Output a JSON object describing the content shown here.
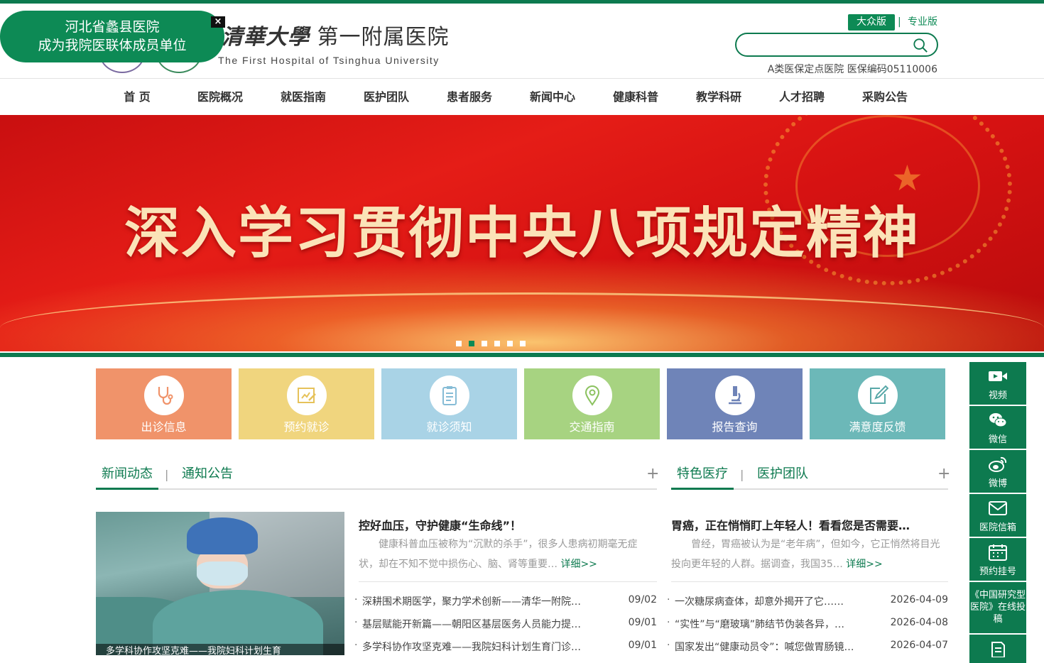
{
  "header": {
    "logo_calligraphy": "清華大學",
    "logo_name": "第一附属医院",
    "logo_en": "The First Hospital of Tsinghua University",
    "badge_line1": "河北省蠡县医院",
    "badge_line2": "成为我院医联体成员单位",
    "badge_close": "×",
    "version_public": "大众版",
    "version_sep": "|",
    "version_pro": "专业版",
    "search_placeholder": "",
    "insurance": "A类医保定点医院  医保编码05110006"
  },
  "nav": [
    "首 页",
    "医院概况",
    "就医指南",
    "医护团队",
    "患者服务",
    "新闻中心",
    "健康科普",
    "教学科研",
    "人才招聘",
    "采购公告"
  ],
  "banner": {
    "text": "深入学习贯彻中央八项规定精神",
    "slide_count": 6,
    "active_slide": 2
  },
  "tiles": [
    {
      "label": "出诊信息",
      "color": "#f0936a",
      "icon": "stethoscope-icon"
    },
    {
      "label": "预约就诊",
      "color": "#f0d57e",
      "icon": "appointment-icon"
    },
    {
      "label": "就诊须知",
      "color": "#a9d3e6",
      "icon": "clipboard-icon"
    },
    {
      "label": "交通指南",
      "color": "#a7d381",
      "icon": "map-pin-icon"
    },
    {
      "label": "报告查询",
      "color": "#6f84b8",
      "icon": "microscope-icon"
    },
    {
      "label": "满意度反馈",
      "color": "#6cb8b8",
      "icon": "edit-icon"
    }
  ],
  "sidebar": [
    {
      "label": "视频",
      "icon": "video-icon"
    },
    {
      "label": "微信",
      "icon": "wechat-icon"
    },
    {
      "label": "微博",
      "icon": "weibo-icon"
    },
    {
      "label": "医院信箱",
      "icon": "mail-icon"
    },
    {
      "label": "预约挂号",
      "icon": "calendar-icon"
    },
    {
      "label": "《中国研究型医院》在线投稿",
      "icon": ""
    },
    {
      "label": "",
      "icon": "document-icon"
    }
  ],
  "news": {
    "tab_active": "新闻动态",
    "tab_other": "通知公告",
    "plus": "+",
    "image_caption": "多学科协作攻坚克难——我院妇科计划生育",
    "headline": "控好血压，守护健康“生命线”！",
    "summary": "健康科普血压被称为“沉默的杀手”，很多人患病初期毫无症状，却在不知不觉中损伤心、脑、肾等重要…",
    "more": "详细>>",
    "items": [
      {
        "title": "深耕围术期医学，聚力学术创新——清华一附院…",
        "date": "09/02"
      },
      {
        "title": "基层赋能开新篇——朝阳区基层医务人员能力提…",
        "date": "09/01"
      },
      {
        "title": "多学科协作攻坚克难——我院妇科计划生育门诊…",
        "date": "09/01"
      }
    ]
  },
  "special": {
    "tab_active": "特色医疗",
    "tab_other": "医护团队",
    "plus": "+",
    "headline": "胃癌，正在悄悄盯上年轻人！看看您是否需要…",
    "summary": "曾经，胃癌被认为是“老年病”，但如今，它正悄然将目光投向更年轻的人群。据调查，我国35…",
    "more": "详细>>",
    "items": [
      {
        "title": "一次糖尿病查体，却意外揭开了它……",
        "date": "2026-04-09"
      },
      {
        "title": "“实性”与“磨玻璃”肺结节伪装各异，…",
        "date": "2026-04-08"
      },
      {
        "title": "国家发出“健康动员令”：喊您做胃肠镜…",
        "date": "2026-04-07"
      }
    ]
  },
  "colors": {
    "brand": "#0d7a4f",
    "banner": "#d61212"
  }
}
